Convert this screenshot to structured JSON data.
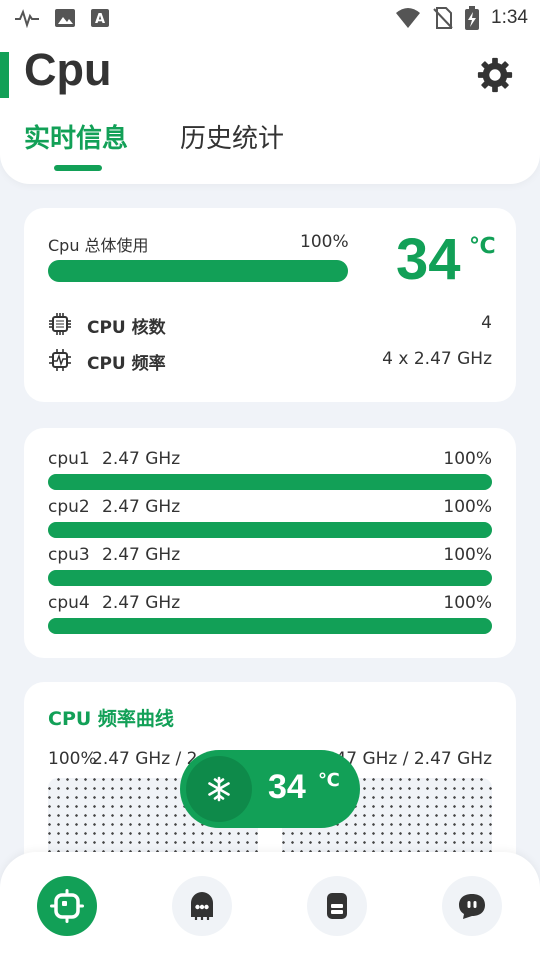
{
  "status_bar": {
    "time": "1:34"
  },
  "header": {
    "title": "Cpu",
    "tabs": [
      {
        "label": "实时信息",
        "active": true
      },
      {
        "label": "历史统计",
        "active": false
      }
    ]
  },
  "summary": {
    "usage_label": "Cpu 总体使用",
    "usage_percent_text": "100%",
    "usage_value": 1.0,
    "temperature": "34",
    "temperature_unit": "℃",
    "cores_label": "CPU 核数",
    "cores_value": "4",
    "freq_label": "CPU 频率",
    "freq_value": "4 x 2.47 GHz"
  },
  "cores": [
    {
      "name": "cpu1",
      "freq": "2.47 GHz",
      "percent_text": "100%",
      "usage": 1.0
    },
    {
      "name": "cpu2",
      "freq": "2.47 GHz",
      "percent_text": "100%",
      "usage": 1.0
    },
    {
      "name": "cpu3",
      "freq": "2.47 GHz",
      "percent_text": "100%",
      "usage": 1.0
    },
    {
      "name": "cpu4",
      "freq": "2.47 GHz",
      "percent_text": "100%",
      "usage": 1.0
    }
  ],
  "freq_curve": {
    "title": "CPU 频率曲线",
    "left_percent": "100%",
    "left_freq": "2.47 GHz / 2.4",
    "right_freq": "47 GHz / 2.47 GHz"
  },
  "floating_temp": {
    "value": "34",
    "unit": "℃"
  },
  "colors": {
    "accent": "#12a057",
    "background": "#f0f3f8"
  }
}
